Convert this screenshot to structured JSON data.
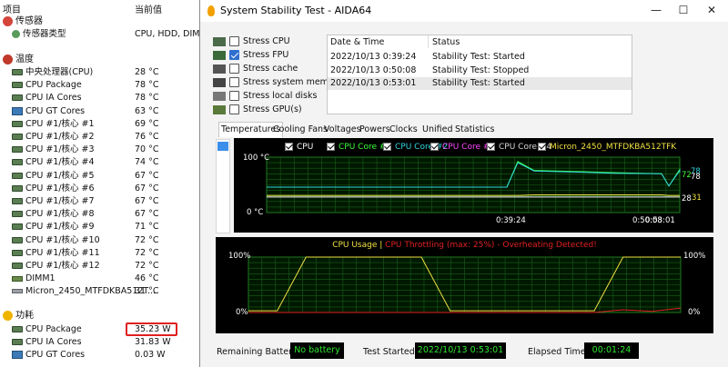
{
  "sensor_panel": {
    "col_item": "项目",
    "col_value": "当前值",
    "groups": [
      {
        "label": "传感器",
        "icon": "sensor-icon",
        "color": "#d4453a"
      },
      {
        "label": "温度",
        "icon": "thermometer-icon",
        "color": "#c0392b"
      },
      {
        "label": "功耗",
        "icon": "power-icon",
        "color": "#f0b400"
      }
    ],
    "sensor_type": {
      "label": "传感器类型",
      "value": "CPU, HDD, DIMM"
    },
    "temperatures": [
      {
        "label": "中央处理器(CPU)",
        "value": "28 °C",
        "icon": "chip-icon"
      },
      {
        "label": "CPU Package",
        "value": "78 °C",
        "icon": "chip-icon"
      },
      {
        "label": "CPU IA Cores",
        "value": "78 °C",
        "icon": "chip-icon"
      },
      {
        "label": "CPU GT Cores",
        "value": "63 °C",
        "icon": "gpu-icon"
      },
      {
        "label": "CPU #1/核心 #1",
        "value": "69 °C",
        "icon": "chip-icon"
      },
      {
        "label": "CPU #1/核心 #2",
        "value": "76 °C",
        "icon": "chip-icon"
      },
      {
        "label": "CPU #1/核心 #3",
        "value": "70 °C",
        "icon": "chip-icon"
      },
      {
        "label": "CPU #1/核心 #4",
        "value": "74 °C",
        "icon": "chip-icon"
      },
      {
        "label": "CPU #1/核心 #5",
        "value": "67 °C",
        "icon": "chip-icon"
      },
      {
        "label": "CPU #1/核心 #6",
        "value": "67 °C",
        "icon": "chip-icon"
      },
      {
        "label": "CPU #1/核心 #7",
        "value": "67 °C",
        "icon": "chip-icon"
      },
      {
        "label": "CPU #1/核心 #8",
        "value": "67 °C",
        "icon": "chip-icon"
      },
      {
        "label": "CPU #1/核心 #9",
        "value": "71 °C",
        "icon": "chip-icon"
      },
      {
        "label": "CPU #1/核心 #10",
        "value": "72 °C",
        "icon": "chip-icon"
      },
      {
        "label": "CPU #1/核心 #11",
        "value": "72 °C",
        "icon": "chip-icon"
      },
      {
        "label": "CPU #1/核心 #12",
        "value": "72 °C",
        "icon": "chip-icon"
      },
      {
        "label": "DIMM1",
        "value": "46 °C",
        "icon": "dimm-icon"
      },
      {
        "label": "Micron_2450_MTFDKBA512T...",
        "value": "31 °C",
        "icon": "ssd-icon"
      }
    ],
    "power": [
      {
        "label": "CPU Package",
        "value": "35.23 W",
        "icon": "chip-icon"
      },
      {
        "label": "CPU IA Cores",
        "value": "31.83 W",
        "icon": "chip-icon"
      },
      {
        "label": "CPU GT Cores",
        "value": "0.03 W",
        "icon": "gpu-icon"
      }
    ],
    "highlight_color": "#e02020"
  },
  "window": {
    "title": "System Stability Test - AIDA64",
    "controls": {
      "minimize": "—",
      "maximize": "☐",
      "close": "✕"
    },
    "stress_options": [
      {
        "label": "Stress CPU",
        "checked": false,
        "icon": "cpu-icon"
      },
      {
        "label": "Stress FPU",
        "checked": true,
        "icon": "fpu-icon"
      },
      {
        "label": "Stress cache",
        "checked": false,
        "icon": "cache-icon"
      },
      {
        "label": "Stress system memory",
        "checked": false,
        "icon": "memory-icon"
      },
      {
        "label": "Stress local disks",
        "checked": false,
        "icon": "disk-icon"
      },
      {
        "label": "Stress GPU(s)",
        "checked": false,
        "icon": "gpu-icon"
      }
    ],
    "log": {
      "col_date": "Date & Time",
      "col_status": "Status",
      "rows": [
        {
          "date": "2022/10/13 0:39:24",
          "status": "Stability Test: Started"
        },
        {
          "date": "2022/10/13 0:50:08",
          "status": "Stability Test: Stopped"
        },
        {
          "date": "2022/10/13 0:53:01",
          "status": "Stability Test: Started"
        }
      ]
    },
    "tabs": [
      "Temperatures",
      "Cooling Fans",
      "Voltages",
      "Powers",
      "Clocks",
      "Unified",
      "Statistics"
    ],
    "active_tab": "Temperatures",
    "bottom": {
      "battery_label": "Remaining Battery:",
      "battery_value": "No battery",
      "started_label": "Test Started:",
      "started_value": "2022/10/13 0:53:01",
      "elapsed_label": "Elapsed Time:",
      "elapsed_value": "00:01:24"
    }
  },
  "chart_data": [
    {
      "type": "line",
      "legend": [
        {
          "name": "CPU",
          "color": "#ffffff"
        },
        {
          "name": "CPU Core #1",
          "color": "#3cff3c"
        },
        {
          "name": "CPU Core #2",
          "color": "#2fd6e0"
        },
        {
          "name": "CPU Core #3",
          "color": "#ff48ff"
        },
        {
          "name": "CPU Core #4",
          "color": "#d8d8d8"
        },
        {
          "name": "Micron_2450_MTFDKBA512TFK",
          "color": "#f0e040"
        }
      ],
      "y_top_label": "100 °C",
      "y_bottom_label": "0 °C",
      "ylim": [
        0,
        100
      ],
      "x_labels": [
        "0:39:24",
        "0:50:08",
        "0:53:01"
      ],
      "right_labels": [
        "78",
        "72",
        "78",
        "28",
        "31"
      ],
      "grid": true,
      "series": [
        {
          "name": "CPU",
          "values": [
            28,
            28,
            28,
            28,
            28,
            28,
            28,
            28,
            28,
            28
          ]
        },
        {
          "name": "CPU Core #1",
          "values": [
            46,
            46,
            92,
            76,
            74,
            72,
            70,
            48,
            78,
            72
          ]
        },
        {
          "name": "CPU Core #2",
          "values": [
            46,
            46,
            90,
            75,
            73,
            71,
            70,
            48,
            76,
            73
          ]
        },
        {
          "name": "Micron_2450_MTFDKBA512TFK",
          "values": [
            31,
            31,
            31,
            32,
            32,
            32,
            32,
            31,
            31,
            31
          ]
        }
      ]
    },
    {
      "type": "line",
      "title": "CPU Usage",
      "title2": "CPU Throttling (max: 25%) - Overheating Detected!",
      "title_color": "#f0e040",
      "title2_color": "#e02020",
      "y_top_left": "100%",
      "y_bottom_left": "0%",
      "y_top_right": "100%",
      "y_bottom_right": "0%",
      "ylim": [
        0,
        100
      ],
      "grid": true,
      "series": [
        {
          "name": "CPU Usage",
          "values": [
            3,
            3,
            100,
            100,
            100,
            100,
            100,
            3,
            3,
            3,
            3,
            3,
            3,
            100,
            100,
            100
          ]
        },
        {
          "name": "CPU Throttling",
          "values": [
            0,
            0,
            0,
            0,
            0,
            0,
            0,
            0,
            0,
            0,
            0,
            0,
            0,
            5,
            2,
            8
          ]
        }
      ]
    }
  ]
}
